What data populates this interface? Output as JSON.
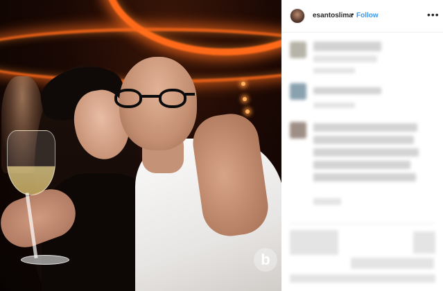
{
  "post": {
    "username": "esantoslima",
    "separator": "•",
    "follow_label": "Follow",
    "more_icon": "more-options-icon",
    "avatar_icon": "profile-avatar"
  },
  "photo": {
    "watermark_letter": "b"
  },
  "colors": {
    "follow_blue": "#3897f0",
    "text_dark": "#262626",
    "ceiling_glow": "#ff6a1a"
  }
}
